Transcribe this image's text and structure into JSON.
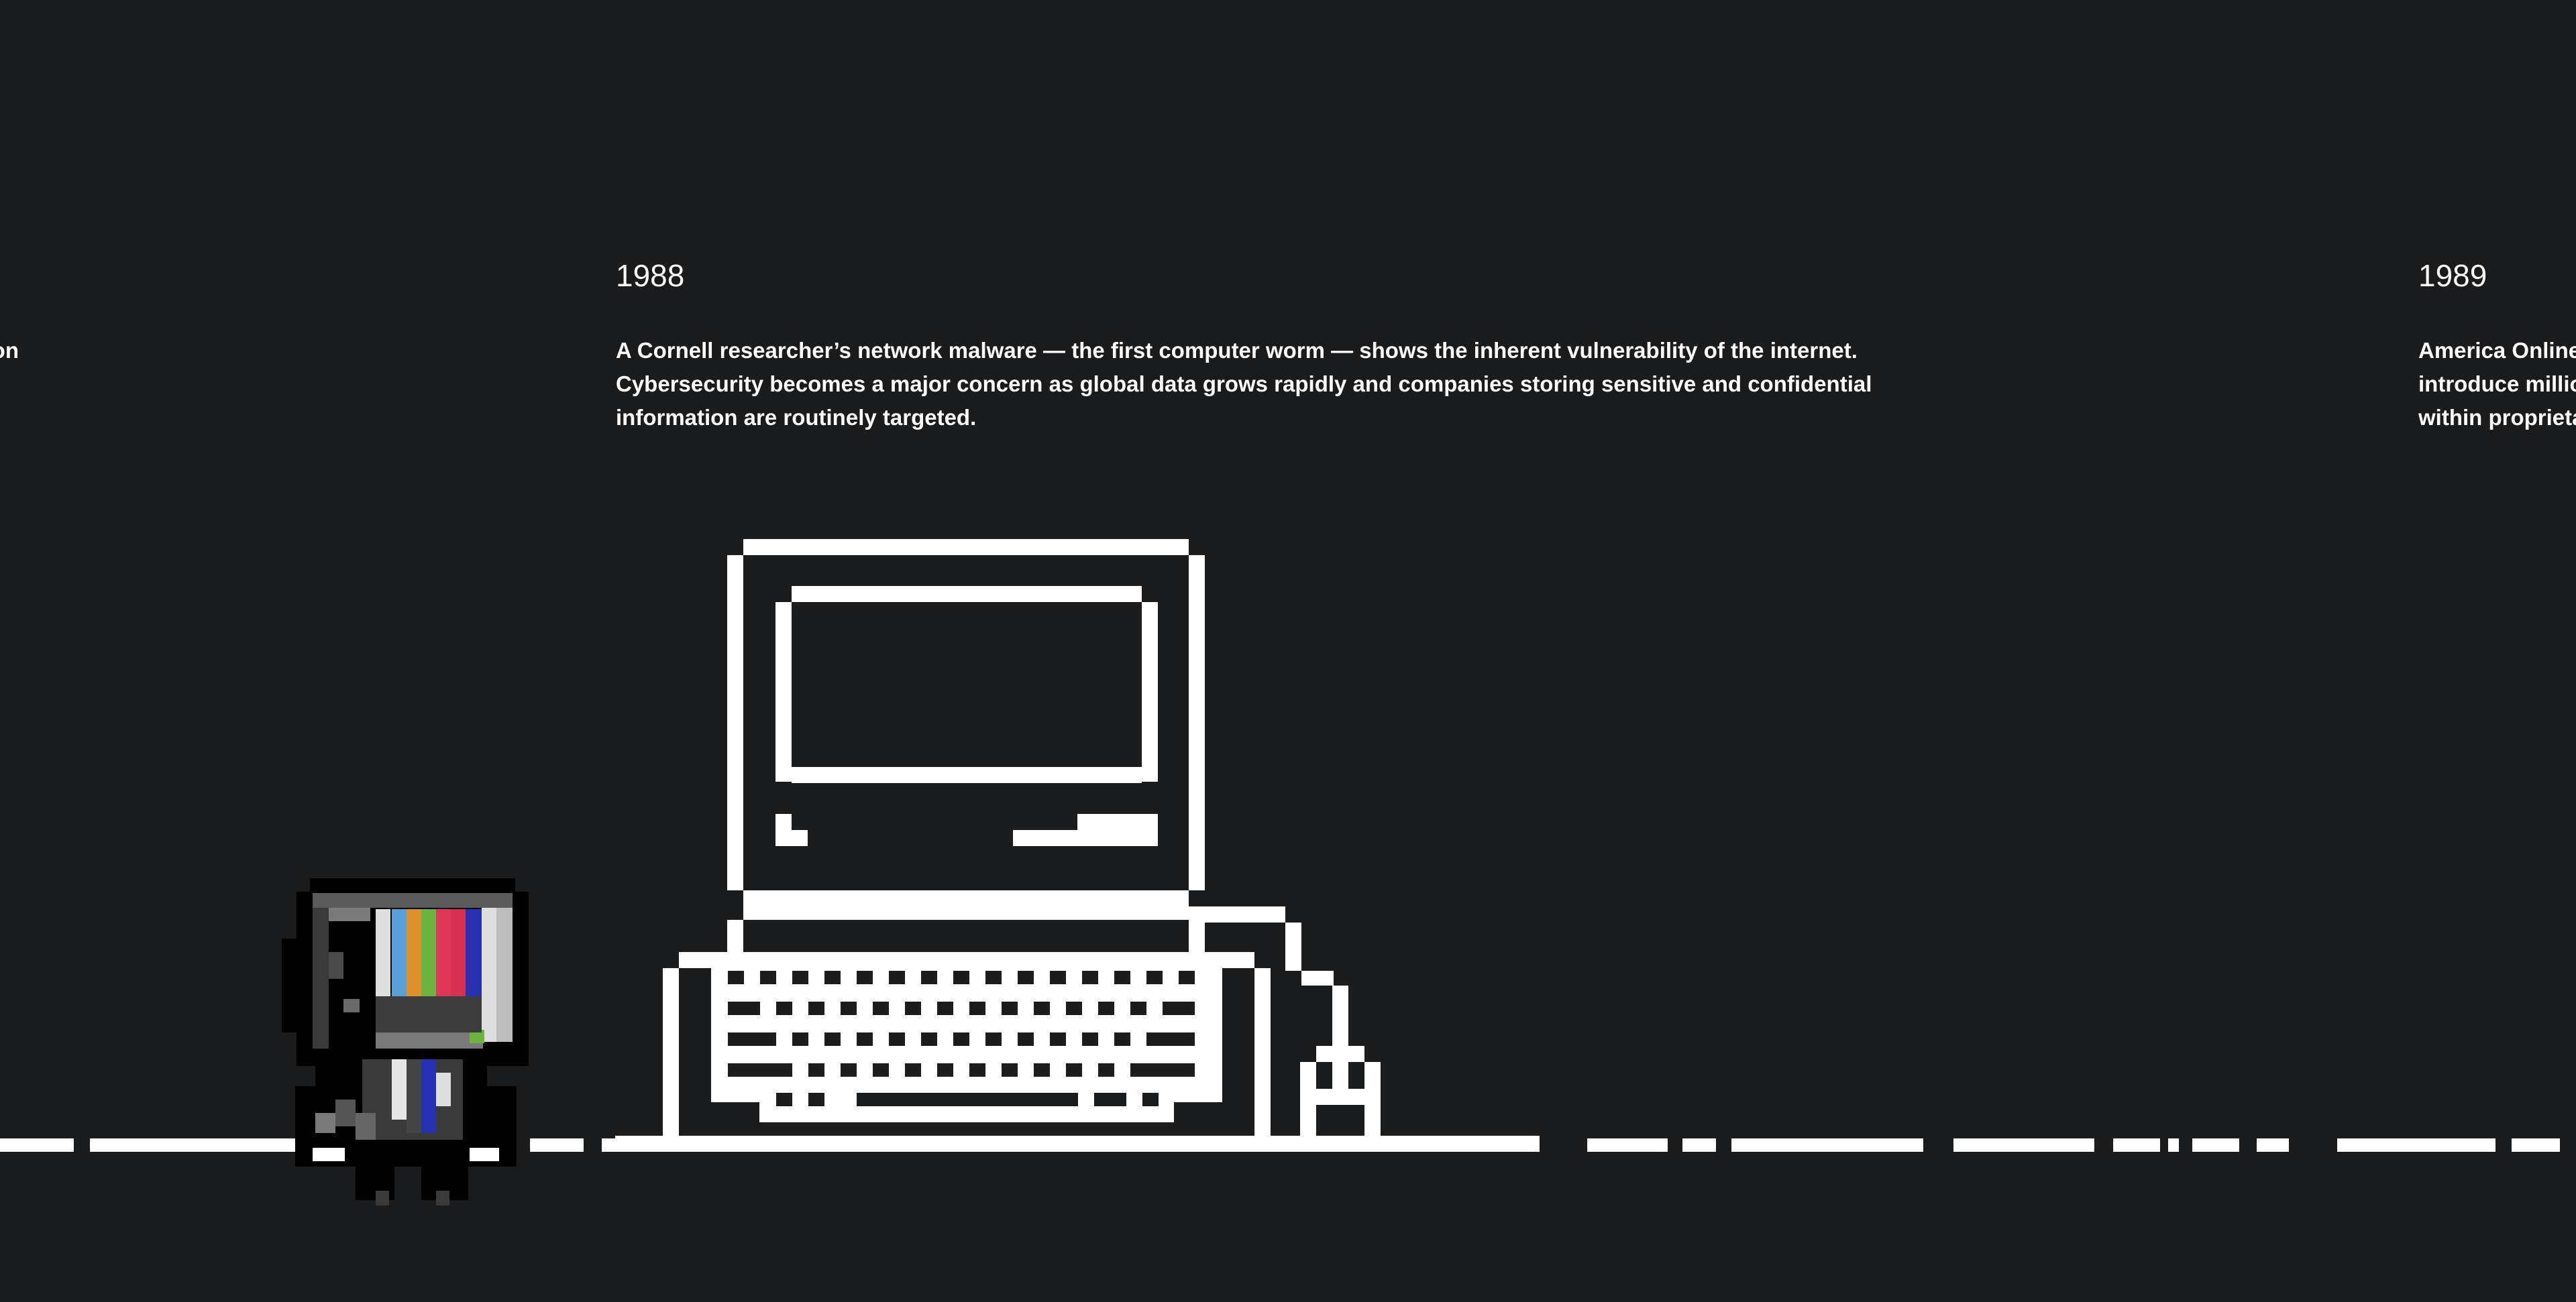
{
  "timeline": {
    "previous": {
      "desc_lines": [
        "ed on"
      ]
    },
    "entry_1988": {
      "year": "1988",
      "desc_lines": [
        "A Cornell researcher’s network malware — the first computer worm — shows the inherent vulnerability of the internet.",
        "Cybersecurity becomes a major concern as global data grows rapidly and companies storing sensitive and confidential",
        "information are routinely targeted."
      ],
      "illustration_icon": "retro-computer-icon"
    },
    "entry_1989": {
      "year": "1989",
      "desc_lines": [
        "America Online",
        "introduce millio",
        "within proprieta"
      ]
    }
  },
  "character": {
    "icon": "tv-head-robot-icon",
    "colors": [
      "#5aa0d8",
      "#e0902a",
      "#6db33f",
      "#e0365a",
      "#2730b0"
    ]
  },
  "colors": {
    "background": "#1a1b1d",
    "foreground": "#ffffff"
  }
}
